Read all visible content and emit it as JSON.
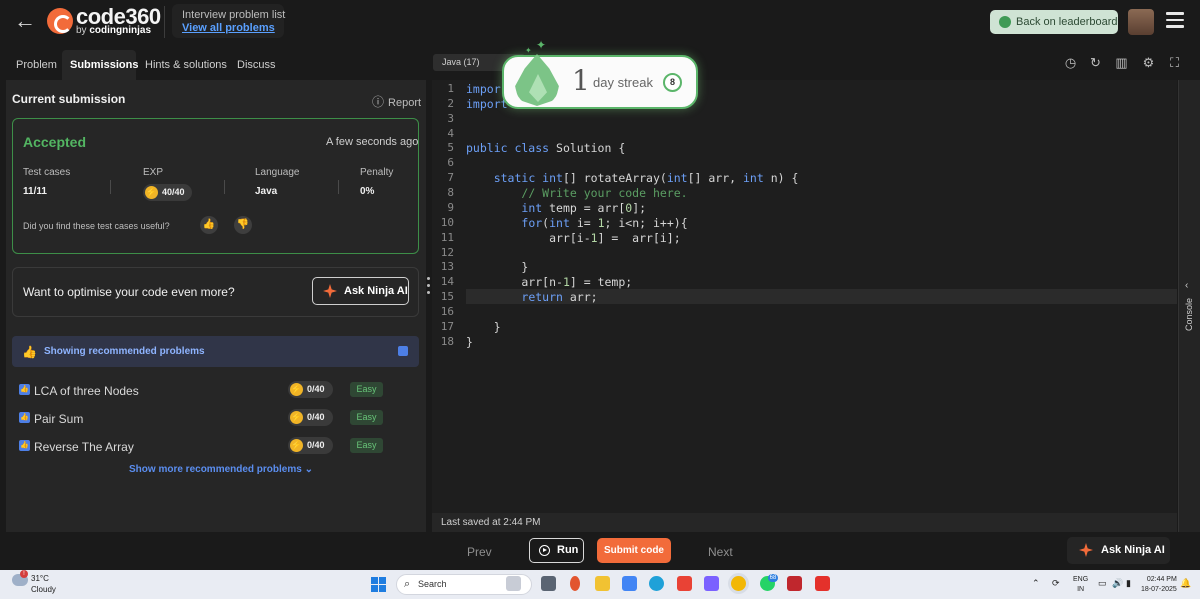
{
  "header": {
    "logo_text": "code360",
    "logo_sub_by": "by",
    "logo_sub_brand": "codingninjas",
    "crumb_title": "Interview problem list",
    "crumb_link": "View all problems",
    "leaderboard_button": "Back on leaderboard"
  },
  "tabs": [
    {
      "label": "Problem",
      "active": false
    },
    {
      "label": "Submissions",
      "active": true
    },
    {
      "label": "Hints & solutions",
      "active": false
    },
    {
      "label": "Discuss",
      "active": false
    }
  ],
  "submission": {
    "heading": "Current submission",
    "report": "Report",
    "status": "Accepted",
    "time": "A few seconds ago",
    "columns": [
      {
        "label": "Test cases",
        "value": "11/11"
      },
      {
        "label": "EXP",
        "value": "40/40"
      },
      {
        "label": "Language",
        "value": "Java"
      },
      {
        "label": "Penalty",
        "value": "0%"
      }
    ],
    "useful_question": "Did you find these test cases useful?",
    "optimise_text": "Want to optimise your code even more?",
    "ask_ninja": "Ask Ninja AI"
  },
  "recommended": {
    "header": "Showing recommended problems",
    "checked": true,
    "problems": [
      {
        "name": "LCA of three Nodes",
        "points": "0/40",
        "difficulty": "Easy"
      },
      {
        "name": "Pair Sum",
        "points": "0/40",
        "difficulty": "Easy"
      },
      {
        "name": "Reverse The Array",
        "points": "0/40",
        "difficulty": "Easy"
      }
    ],
    "show_more": "Show more recommended problems"
  },
  "editor": {
    "language": "Java (17)",
    "line_numbers": [
      "1",
      "2",
      "3",
      "4",
      "5",
      "6",
      "7",
      "8",
      "9",
      "10",
      "11",
      "12",
      "13",
      "14",
      "15",
      "16",
      "17",
      "18"
    ],
    "highlighted_line": 15,
    "saved": "Last saved at 2:44 PM",
    "console_label": "Console"
  },
  "streak": {
    "count": "1",
    "label": "day streak",
    "badge": "8"
  },
  "actions": {
    "prev": "Prev",
    "run": "Run",
    "submit": "Submit code",
    "next": "Next",
    "ask_ninja": "Ask Ninja AI"
  },
  "taskbar": {
    "temperature": "31°C",
    "condition": "Cloudy",
    "search": "Search",
    "lang_line1": "ENG",
    "lang_line2": "IN",
    "time": "02:44 PM",
    "date": "18-07-2025",
    "whatsapp_badge": "68"
  },
  "colors": {
    "accent": "#f26b3a",
    "accepted": "#53b562",
    "link": "#5aa0ff",
    "keyword": "#6c9ff6",
    "comment": "#5b9e63"
  }
}
